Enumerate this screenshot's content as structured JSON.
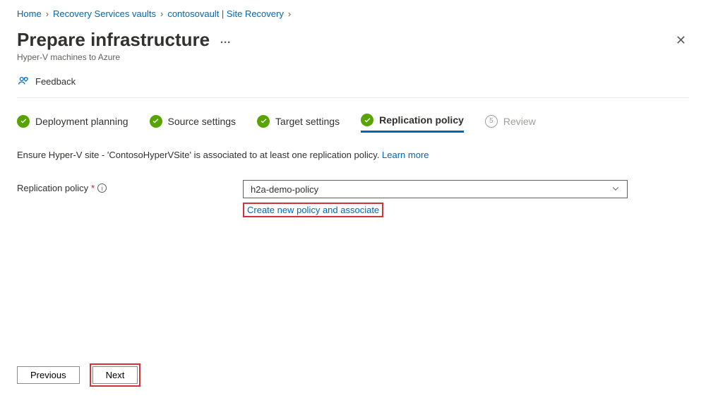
{
  "breadcrumb": {
    "home": "Home",
    "vaults": "Recovery Services vaults",
    "vault": "contosovault | Site Recovery"
  },
  "header": {
    "title": "Prepare infrastructure",
    "subtitle": "Hyper-V machines to Azure"
  },
  "feedback": {
    "label": "Feedback"
  },
  "steps": {
    "s1": "Deployment planning",
    "s2": "Source settings",
    "s3": "Target settings",
    "s4": "Replication policy",
    "s5_num": "5",
    "s5": "Review"
  },
  "intro": {
    "text": "Ensure Hyper-V site - 'ContosoHyperVSite' is associated to at least one replication policy. ",
    "learn_more": "Learn more"
  },
  "field": {
    "label": "Replication policy",
    "required": "*",
    "value": "h2a-demo-policy",
    "create_link": "Create new policy and associate"
  },
  "footer": {
    "previous": "Previous",
    "next": "Next"
  }
}
